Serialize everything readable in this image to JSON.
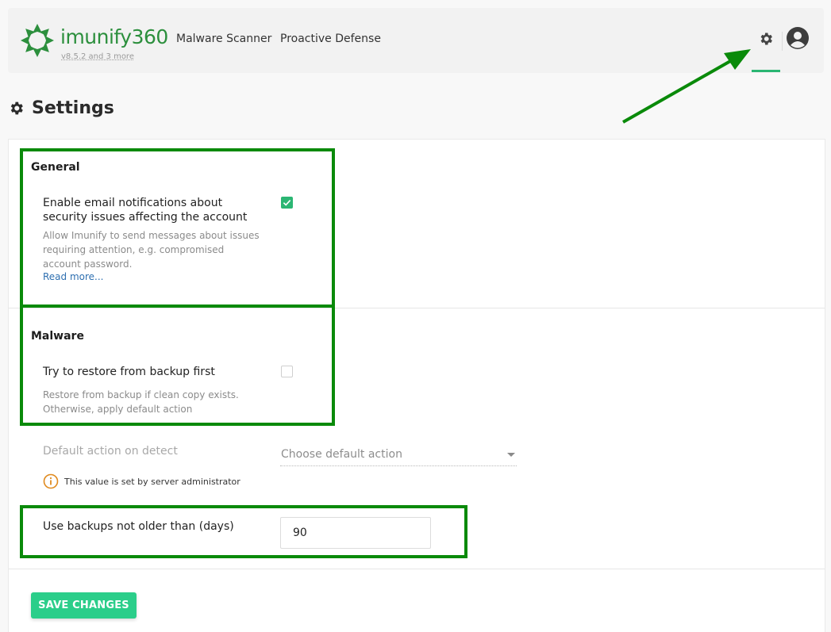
{
  "header": {
    "brand": "imunify360",
    "version": "v8.5.2 and 3 more",
    "nav": [
      "Malware Scanner",
      "Proactive Defense"
    ],
    "settings_icon": "gear-icon",
    "user_icon": "user-avatar-icon",
    "accent_color": "#2bb673"
  },
  "page": {
    "title": "Settings",
    "title_icon": "gear-icon"
  },
  "general": {
    "title": "General",
    "email_label": "Enable email notifications about security issues affecting the account",
    "email_checked": true,
    "email_desc": "Allow Imunify to send messages about issues requiring attention, e.g. compromised account password.",
    "read_more": "Read more..."
  },
  "malware": {
    "title": "Malware",
    "restore_label": "Try to restore from backup first",
    "restore_checked": false,
    "restore_desc": "Restore from backup if clean copy exists. Otherwise, apply default action",
    "default_action_label": "Default action on detect",
    "default_action_placeholder": "Choose default action",
    "admin_note": "This value is set by server administrator",
    "backup_age_label": "Use backups not older than (days)",
    "backup_age_value": "90"
  },
  "actions": {
    "save": "SAVE CHANGES"
  },
  "annotation_color": "#0a8a0a"
}
